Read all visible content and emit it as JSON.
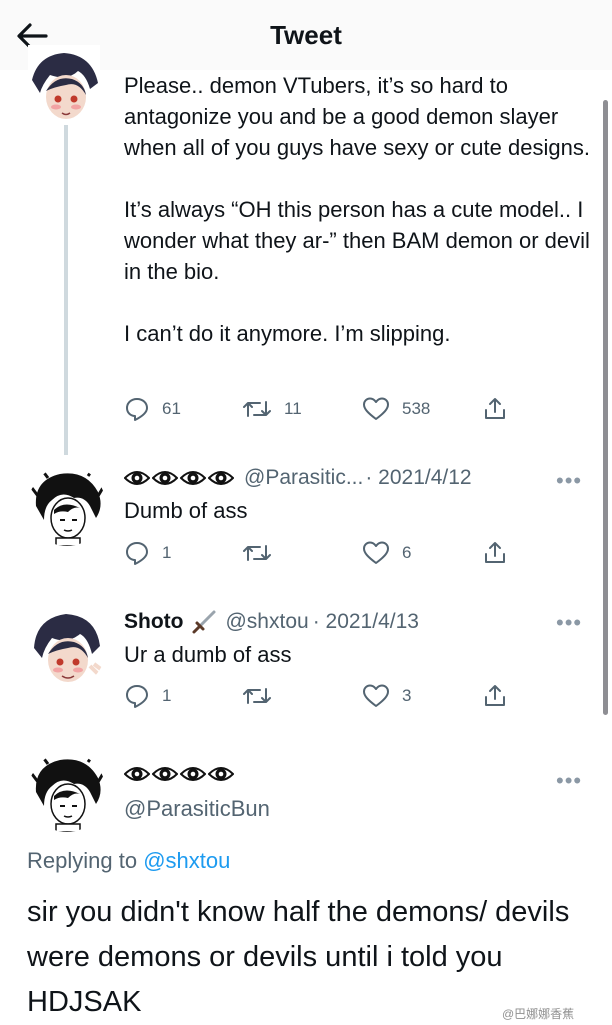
{
  "header": {
    "title": "Tweet",
    "back_icon": "arrow-left-icon"
  },
  "main_tweet": {
    "paragraphs": [
      "Please.. demon VTubers, it’s so hard to antagonize you and be a good demon slayer when all of you guys have sexy or cute designs.",
      "It’s always “OH this person has a cute model.. I wonder what they ar-” then BAM demon or devil in the bio.",
      "I can’t do it anymore. I’m slipping."
    ],
    "replies": "61",
    "retweets": "11",
    "likes": "538"
  },
  "reply1": {
    "display_name": "👁👁👁👁",
    "handle": "@Parasitic...",
    "date": "· 2021/4/12",
    "text": "Dumb of ass",
    "replies": "1",
    "retweets": "",
    "likes": "6"
  },
  "reply2": {
    "display_name": "Shoto",
    "name_icon": "sword-icon",
    "handle": "@shxtou",
    "date": "· 2021/4/13",
    "text": "Ur a dumb of ass",
    "replies": "1",
    "retweets": "",
    "likes": "3"
  },
  "final_tweet": {
    "handle": "@ParasiticBun",
    "replying_prefix": "Replying to ",
    "replying_to": "@shxtou",
    "text": "sir you didn't know half the demons/ devils were demons or devils until i told you HDJSAK"
  },
  "more_label": "•••",
  "watermark": "@巴娜娜香蕉",
  "colors": {
    "text": "#0f1419",
    "secondary": "#536471",
    "link": "#1d9bf0",
    "line": "#cfd9de"
  }
}
